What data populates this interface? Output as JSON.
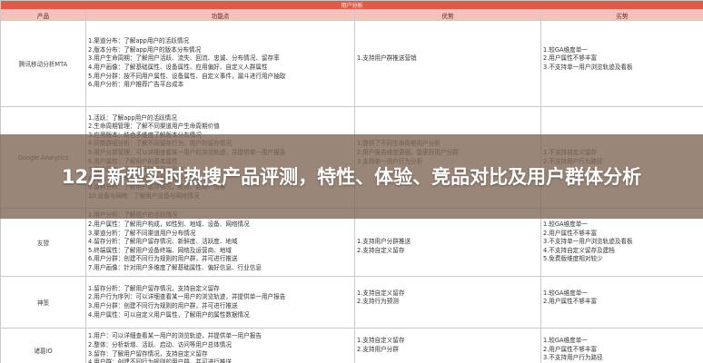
{
  "table": {
    "top_label": "用户分析",
    "headers": [
      "产品",
      "功能点",
      "优势",
      "劣势"
    ],
    "rows": [
      {
        "product": "腾讯移动分析MTA",
        "features": [
          "1.渠道分布：了解app用户的活跃情况",
          "2.版本分布：了解app用户的版本分布情况",
          "3.用户生命周期：了解用户活跃、流失、回流、忠诚、分布情况、留存率",
          "4.用户画像：了解基础属性、设备属性、应用偏好、自定义人群属性",
          "5.用户分群：按不同用户属性、设备属性、自定义事件，漏斗进行用户抽取",
          "6.用户分析：用户推荐广告平台成本"
        ],
        "advantages": [
          "",
          "",
          "1.支持用户群推送营销",
          "",
          "",
          ""
        ],
        "disadvantages": [
          "",
          "1.较GA维度单一",
          "2.用户属性不够丰富",
          "3.不支持单一用户浏览轨迹及看板",
          "",
          ""
        ]
      },
      {
        "product": "Google Analytics",
        "features": [
          "1.活跃：了解app用户的活跃情况",
          "2.生命周期管理：了解不同渠道用户生命周期价值",
          "3.应用版本：结合多维度了解版本分布情况",
          "4.同类群组分析：了解不同留存行为，用户的留存情况",
          "5.用户分群管理：可以详细查看某一用户的浏览轨迹，并提供单一用户报告",
          "6.用户属性：了解用户的基本属性",
          "7.用户留存：了解不同时间用户留存",
          "8.行为：用户参与的相关数据，用户已流失",
          "9.留存分析：了解用户留存情况，按照、启动、访客",
          "10.设备与网络：了解用户设备与网络情况"
        ],
        "advantages": [
          "",
          "",
          "",
          "1.提供了不同生命周期用户分析",
          "2.用户报告维度更细，能更好用户分群",
          "3.支持单一用户行为分析",
          "",
          "",
          "",
          ""
        ],
        "disadvantages": [
          "",
          "",
          "",
          "",
          "1.不支持自定义留存",
          "2.不支持用户行为路径",
          "",
          "",
          "",
          ""
        ]
      },
      {
        "product": "友盟",
        "features": [
          "1.用户分析：了解用户的活跃情况",
          "2.用户属性：了解用户构成，如性别、地域、设备、网络情况",
          "3.渠道分析：了解不同渠道用户分布情况",
          "4.留存分析：了解用户留存情况、新鲜度、活跃度、地域",
          "5.终端属性：了解用户设备终端、网络及运营商、地域",
          "6.用户分群：创建不同行为规则的用户群，并可进行推送",
          "7.用户画像：针对用户多维度了解基础属性、偏好信息、行业信息"
        ],
        "advantages": [
          "",
          "",
          "",
          "1.支持用户分群推送",
          "2.支持自定义留存",
          "",
          ""
        ],
        "disadvantages": [
          "",
          "1.较GA维度单一",
          "2.用户属性不够丰富",
          "3.不支持单一用户浏览轨迹及看板",
          "4.不支持自定义留存及建档",
          "5.免费版维度相对较少",
          ""
        ]
      },
      {
        "product": "神策",
        "features": [
          "1.留存分析：了解用户留存情况，支持自定义留存",
          "2.用户行为序列：可以详细查看某一用户的浏览轨迹，并提供单一用户报告",
          "3.用户分群：创建不同行为规则的用户群，并可进行推送",
          "4.用户属性：可以自定义用户属性，了解用户的属性数据情况"
        ],
        "advantages": [
          "1.支持自定义留存",
          "2.支持行为预测",
          ""
        ],
        "disadvantages": [
          "1.较GA维度单一",
          "2.用户属性不够丰富",
          ""
        ]
      },
      {
        "product": "诸葛IO",
        "features": [
          "1.用户：可以详细查看某一用户的浏览轨迹，并提供单一用户报告",
          "2.整体：分析新增、活跃、启动、访问等用户总体情况",
          "3.留存：了解用户留存情况，支持自定义留存",
          "4.用户群：创建不同行为规则的用户群，并可进行推送"
        ],
        "advantages": [
          "1.支持自定义留存",
          "2.支持用户分群",
          ""
        ],
        "disadvantages": [
          "1.较GA维度单一",
          "2.用户属性不够丰富",
          "3.不支持用户行为路径"
        ]
      }
    ]
  },
  "overlay": {
    "title": "12月新型实时热搜产品评测，特性、体验、竞品对比及用户群体分析"
  },
  "colors": {
    "header_top": "#e05a4a",
    "header": "#f3c2b9",
    "overlay": "#806856",
    "title_text": "#ffffff"
  }
}
